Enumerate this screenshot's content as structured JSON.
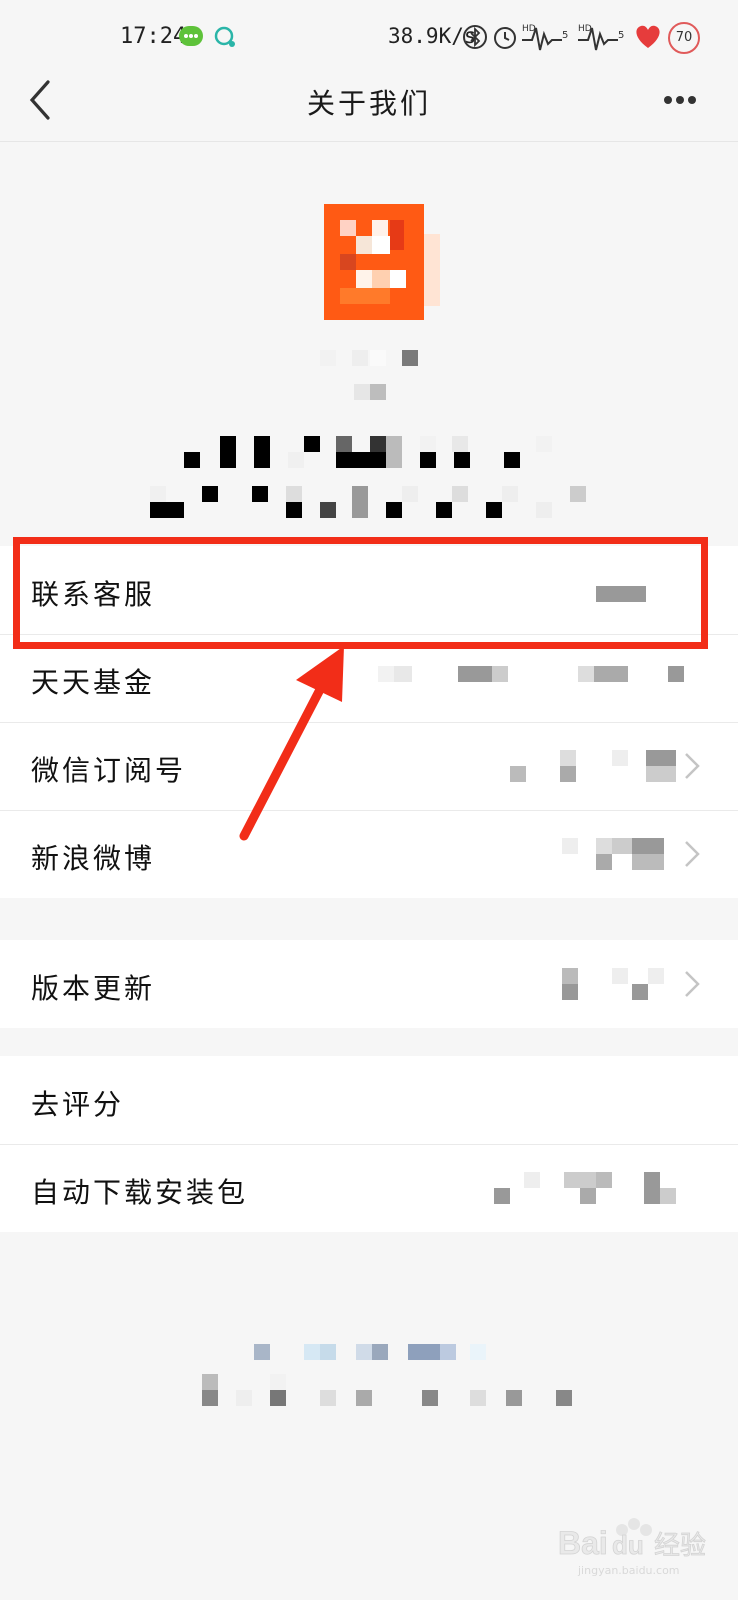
{
  "status_bar": {
    "time": "17:24",
    "net_speed": "38.9K/s",
    "battery": "70",
    "icons": [
      "message-icon",
      "chat-bubble-icon",
      "bluetooth-icon",
      "alarm-icon",
      "signal-hd-icon",
      "signal-hd-icon",
      "heart-app-icon"
    ]
  },
  "nav": {
    "title": "关于我们",
    "back_icon": "chevron-left-icon",
    "more_icon": "more-dots-icon"
  },
  "list": {
    "group1": [
      {
        "label": "联系客服",
        "has_chevron": false
      },
      {
        "label": "天天基金",
        "has_chevron": false
      },
      {
        "label": "微信订阅号",
        "has_chevron": true
      },
      {
        "label": "新浪微博",
        "has_chevron": true
      }
    ],
    "group2": [
      {
        "label": "版本更新",
        "has_chevron": true
      }
    ],
    "group3": [
      {
        "label": "去评分",
        "has_chevron": false
      },
      {
        "label": "自动下载安装包",
        "has_chevron": false
      }
    ]
  },
  "annotation": {
    "highlight_color": "#f22d18"
  },
  "colors": {
    "logo_orange": "#ff5a14",
    "background": "#f6f6f6"
  },
  "watermark": {
    "brand": "Baidu",
    "suffix": "经验",
    "url": "jingyan.baidu.com"
  }
}
